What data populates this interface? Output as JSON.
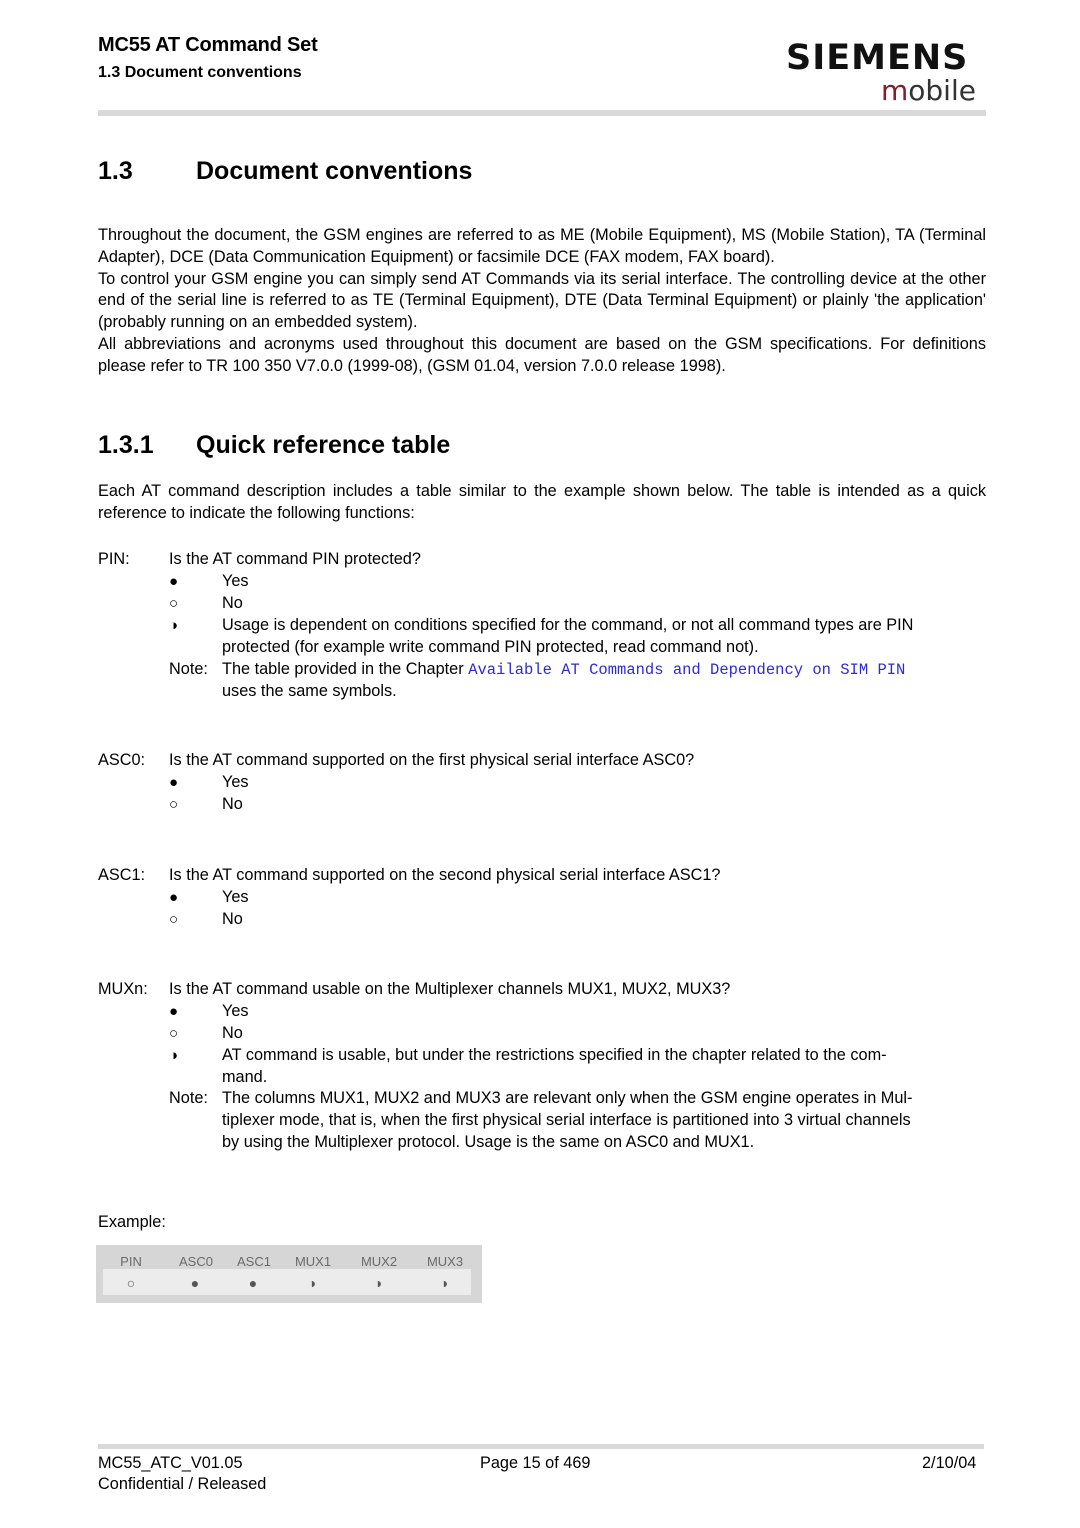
{
  "header": {
    "doc_title": "MC55 AT Command Set",
    "section": "1.3 Document conventions",
    "logo_brand": "SIEMENS",
    "logo_sub_first": "m",
    "logo_sub_rest": "obile"
  },
  "section_heading": {
    "number": "1.3",
    "title": "Document conventions"
  },
  "intro_paragraphs": [
    "Throughout the document, the GSM engines are referred to as ME (Mobile Equipment), MS (Mobile Station), TA (Terminal Adapter), DCE (Data Communication Equipment) or facsimile DCE (FAX modem, FAX board).",
    "To control your GSM engine you can simply send AT Commands via its serial interface. The controlling device at the other end of the serial line is referred to as TE (Terminal Equipment), DTE (Data Terminal Equipment) or plainly 'the application' (probably running on an embedded system).",
    "All abbreviations and acronyms used throughout this document are based on the GSM specifications. For definitions please refer to TR 100 350 V7.0.0 (1999-08), (GSM 01.04, version 7.0.0 release 1998)."
  ],
  "subsection_heading": {
    "number": "1.3.1",
    "title": "Quick reference table"
  },
  "subsection_intro": "Each AT command description includes a table similar to the example shown below. The table is intended as a quick reference to indicate the following functions:",
  "symbols": {
    "filled": "●",
    "empty": "○",
    "half": "◑"
  },
  "pin": {
    "label": "PIN:",
    "question": "Is the AT command PIN protected?",
    "yes": "Yes",
    "no": "No",
    "half_line1": "Usage is dependent on conditions specified for the command, or not all command types are PIN",
    "half_line2": "protected (for example write command PIN protected, read command not).",
    "note_label": "Note:",
    "note_text": "The table provided in the Chapter ",
    "note_link": "Available AT Commands and Dependency on SIM PIN",
    "note_text2": "uses the same symbols."
  },
  "asc0": {
    "label": "ASC0:",
    "question": "Is the AT command supported on the first physical serial interface ASC0?",
    "yes": "Yes",
    "no": "No"
  },
  "asc1": {
    "label": "ASC1:",
    "question": "Is the AT command supported on the second physical serial interface ASC1?",
    "yes": "Yes",
    "no": "No"
  },
  "muxn": {
    "label": "MUXn:",
    "question": "Is the AT command usable on the Multiplexer channels MUX1, MUX2, MUX3?",
    "yes": "Yes",
    "no": "No",
    "half_line1": "AT command is usable, but under the restrictions specified in the chapter related to the com-",
    "half_line2": "mand.",
    "note_label": "Note:",
    "note_line1": "The columns MUX1, MUX2 and MUX3 are relevant only when the GSM engine operates in Mul-",
    "note_line2": "tiplexer mode, that is, when the first physical serial interface is partitioned into 3 virtual channels",
    "note_line3": "by using the Multiplexer protocol. Usage is the same on ASC0 and MUX1."
  },
  "example": {
    "label": "Example:",
    "columns": [
      "PIN",
      "ASC0",
      "ASC1",
      "MUX1",
      "MUX2",
      "MUX3"
    ],
    "values": [
      "○",
      "●",
      "●",
      "◑",
      "◑",
      "◑"
    ]
  },
  "footer": {
    "doc_id": "MC55_ATC_V01.05",
    "page": "Page 15 of 469",
    "date": "2/10/04",
    "classification": "Confidential / Released"
  }
}
